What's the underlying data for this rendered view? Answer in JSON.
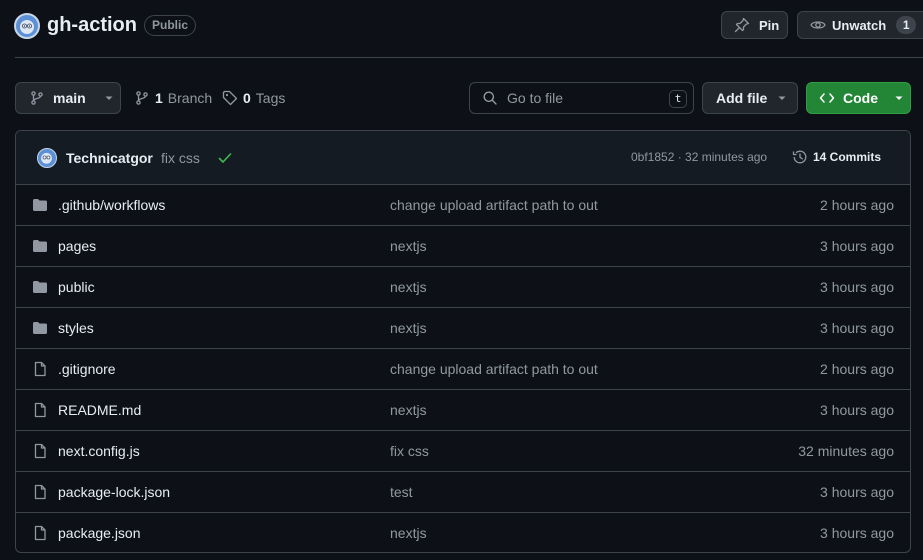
{
  "repo": {
    "name": "gh-action",
    "visibility": "Public"
  },
  "actions": {
    "pin_label": "Pin",
    "watch_label": "Unwatch",
    "watch_count": "1"
  },
  "toolbar": {
    "branch_name": "main",
    "branch_count": "1",
    "branch_label": "Branch",
    "tag_count": "0",
    "tag_label": "Tags",
    "search_placeholder": "Go to file",
    "search_shortcut": "t",
    "add_file_label": "Add file",
    "code_label": "Code"
  },
  "commit": {
    "author": "Technicatgor",
    "message": "fix css",
    "meta": "0bf1852 · 32 minutes ago",
    "commits_label": "14 Commits"
  },
  "files": [
    {
      "type": "folder",
      "name": ".github/workflows",
      "message": "change upload artifact path to out",
      "time": "2 hours ago"
    },
    {
      "type": "folder",
      "name": "pages",
      "message": "nextjs",
      "time": "3 hours ago"
    },
    {
      "type": "folder",
      "name": "public",
      "message": "nextjs",
      "time": "3 hours ago"
    },
    {
      "type": "folder",
      "name": "styles",
      "message": "nextjs",
      "time": "3 hours ago"
    },
    {
      "type": "file",
      "name": ".gitignore",
      "message": "change upload artifact path to out",
      "time": "2 hours ago"
    },
    {
      "type": "file",
      "name": "README.md",
      "message": "nextjs",
      "time": "3 hours ago"
    },
    {
      "type": "file",
      "name": "next.config.js",
      "message": "fix css",
      "time": "32 minutes ago"
    },
    {
      "type": "file",
      "name": "package-lock.json",
      "message": "test",
      "time": "3 hours ago"
    },
    {
      "type": "file",
      "name": "package.json",
      "message": "nextjs",
      "time": "3 hours ago"
    }
  ],
  "colors": {
    "background": "#0d1117",
    "border": "#3d444d",
    "muted_text": "#9198a1",
    "code_button": "#238636",
    "success": "#3fb950"
  }
}
